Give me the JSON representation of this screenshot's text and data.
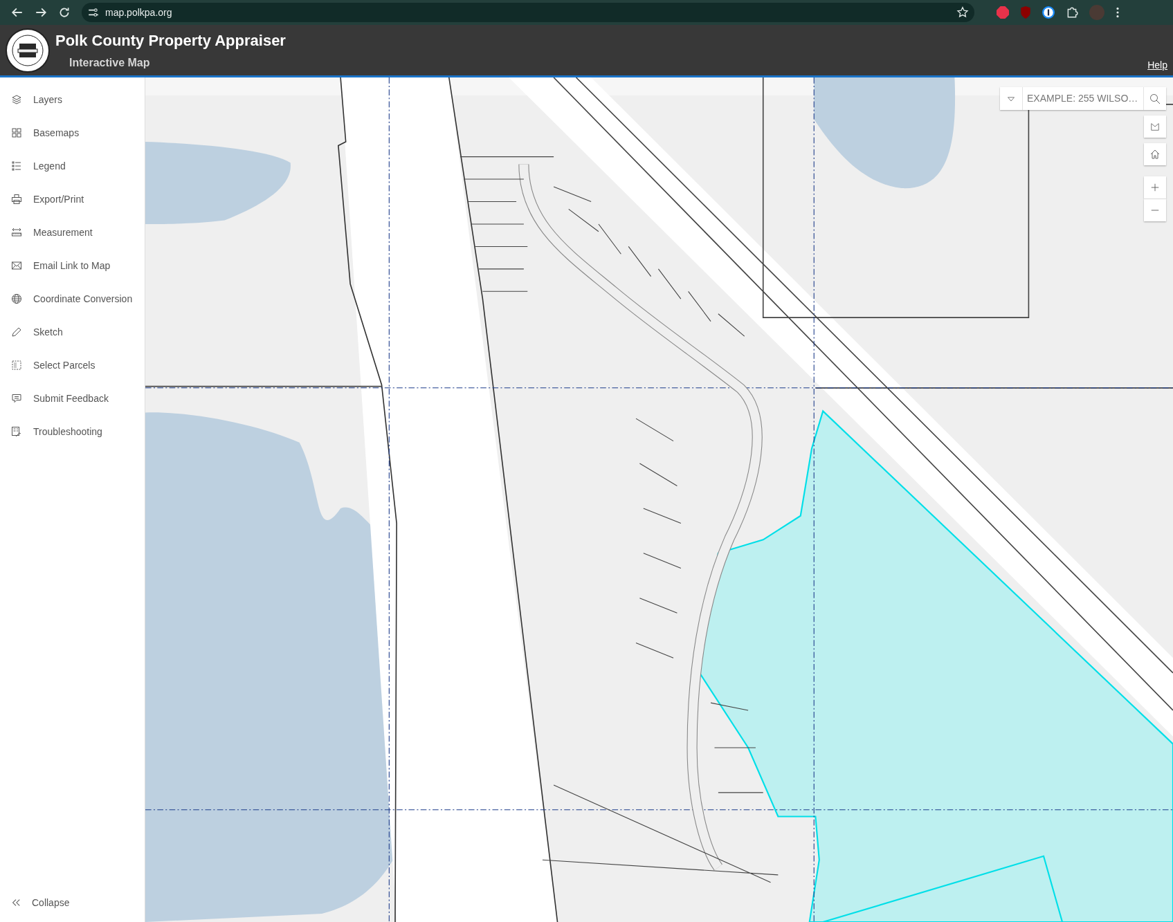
{
  "browser": {
    "url": "map.polkpa.org"
  },
  "header": {
    "title": "Polk County Property Appraiser",
    "subtitle": "Interactive Map",
    "help_link": "Help"
  },
  "sidebar": {
    "items": [
      {
        "label": "Layers"
      },
      {
        "label": "Basemaps"
      },
      {
        "label": "Legend"
      },
      {
        "label": "Export/Print"
      },
      {
        "label": "Measurement"
      },
      {
        "label": "Email Link to Map"
      },
      {
        "label": "Coordinate Conversion"
      },
      {
        "label": "Sketch"
      },
      {
        "label": "Select Parcels"
      },
      {
        "label": "Submit Feedback"
      },
      {
        "label": "Troubleshooting"
      }
    ],
    "collapse": "Collapse"
  },
  "search": {
    "placeholder": "EXAMPLE: 255 WILSO…"
  }
}
